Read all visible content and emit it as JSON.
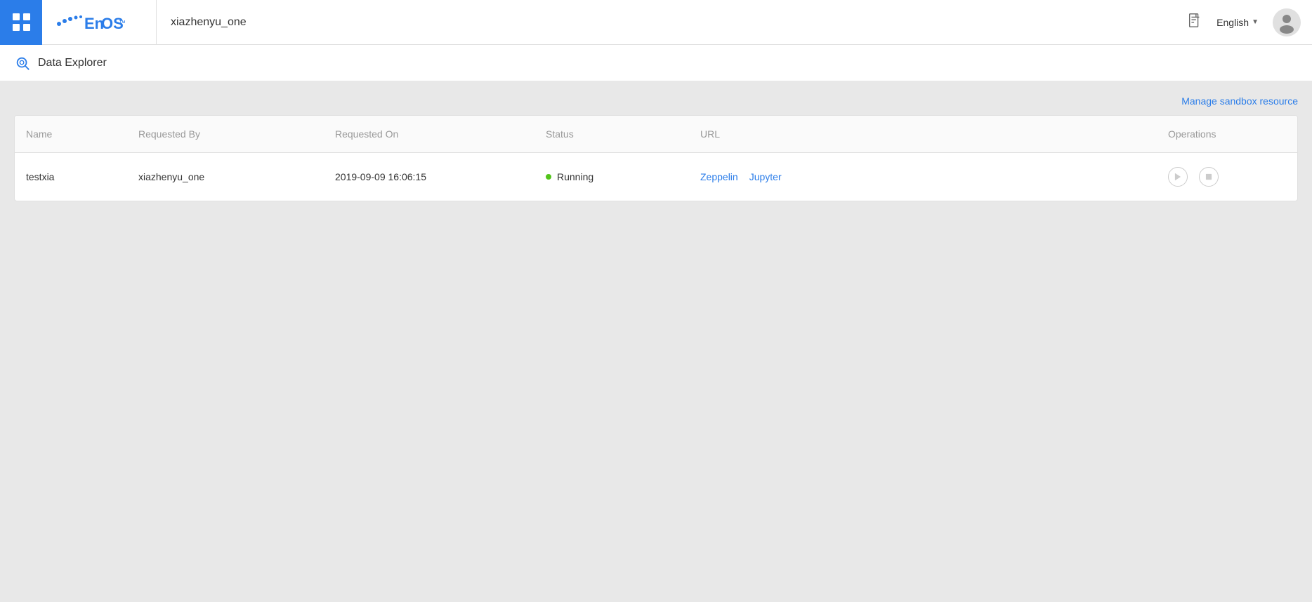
{
  "nav": {
    "workspace": "xiazhenyu_one",
    "language": "English",
    "apps_label": "apps"
  },
  "sub_header": {
    "title": "Data Explorer"
  },
  "main": {
    "manage_link": "Manage sandbox resource",
    "table": {
      "columns": [
        "Name",
        "Requested By",
        "Requested On",
        "Status",
        "URL",
        "Operations"
      ],
      "rows": [
        {
          "name": "testxia",
          "requested_by": "xiazhenyu_one",
          "requested_on": "2019-09-09 16:06:15",
          "status": "Running",
          "urls": [
            "Zeppelin",
            "Jupyter"
          ]
        }
      ]
    }
  }
}
